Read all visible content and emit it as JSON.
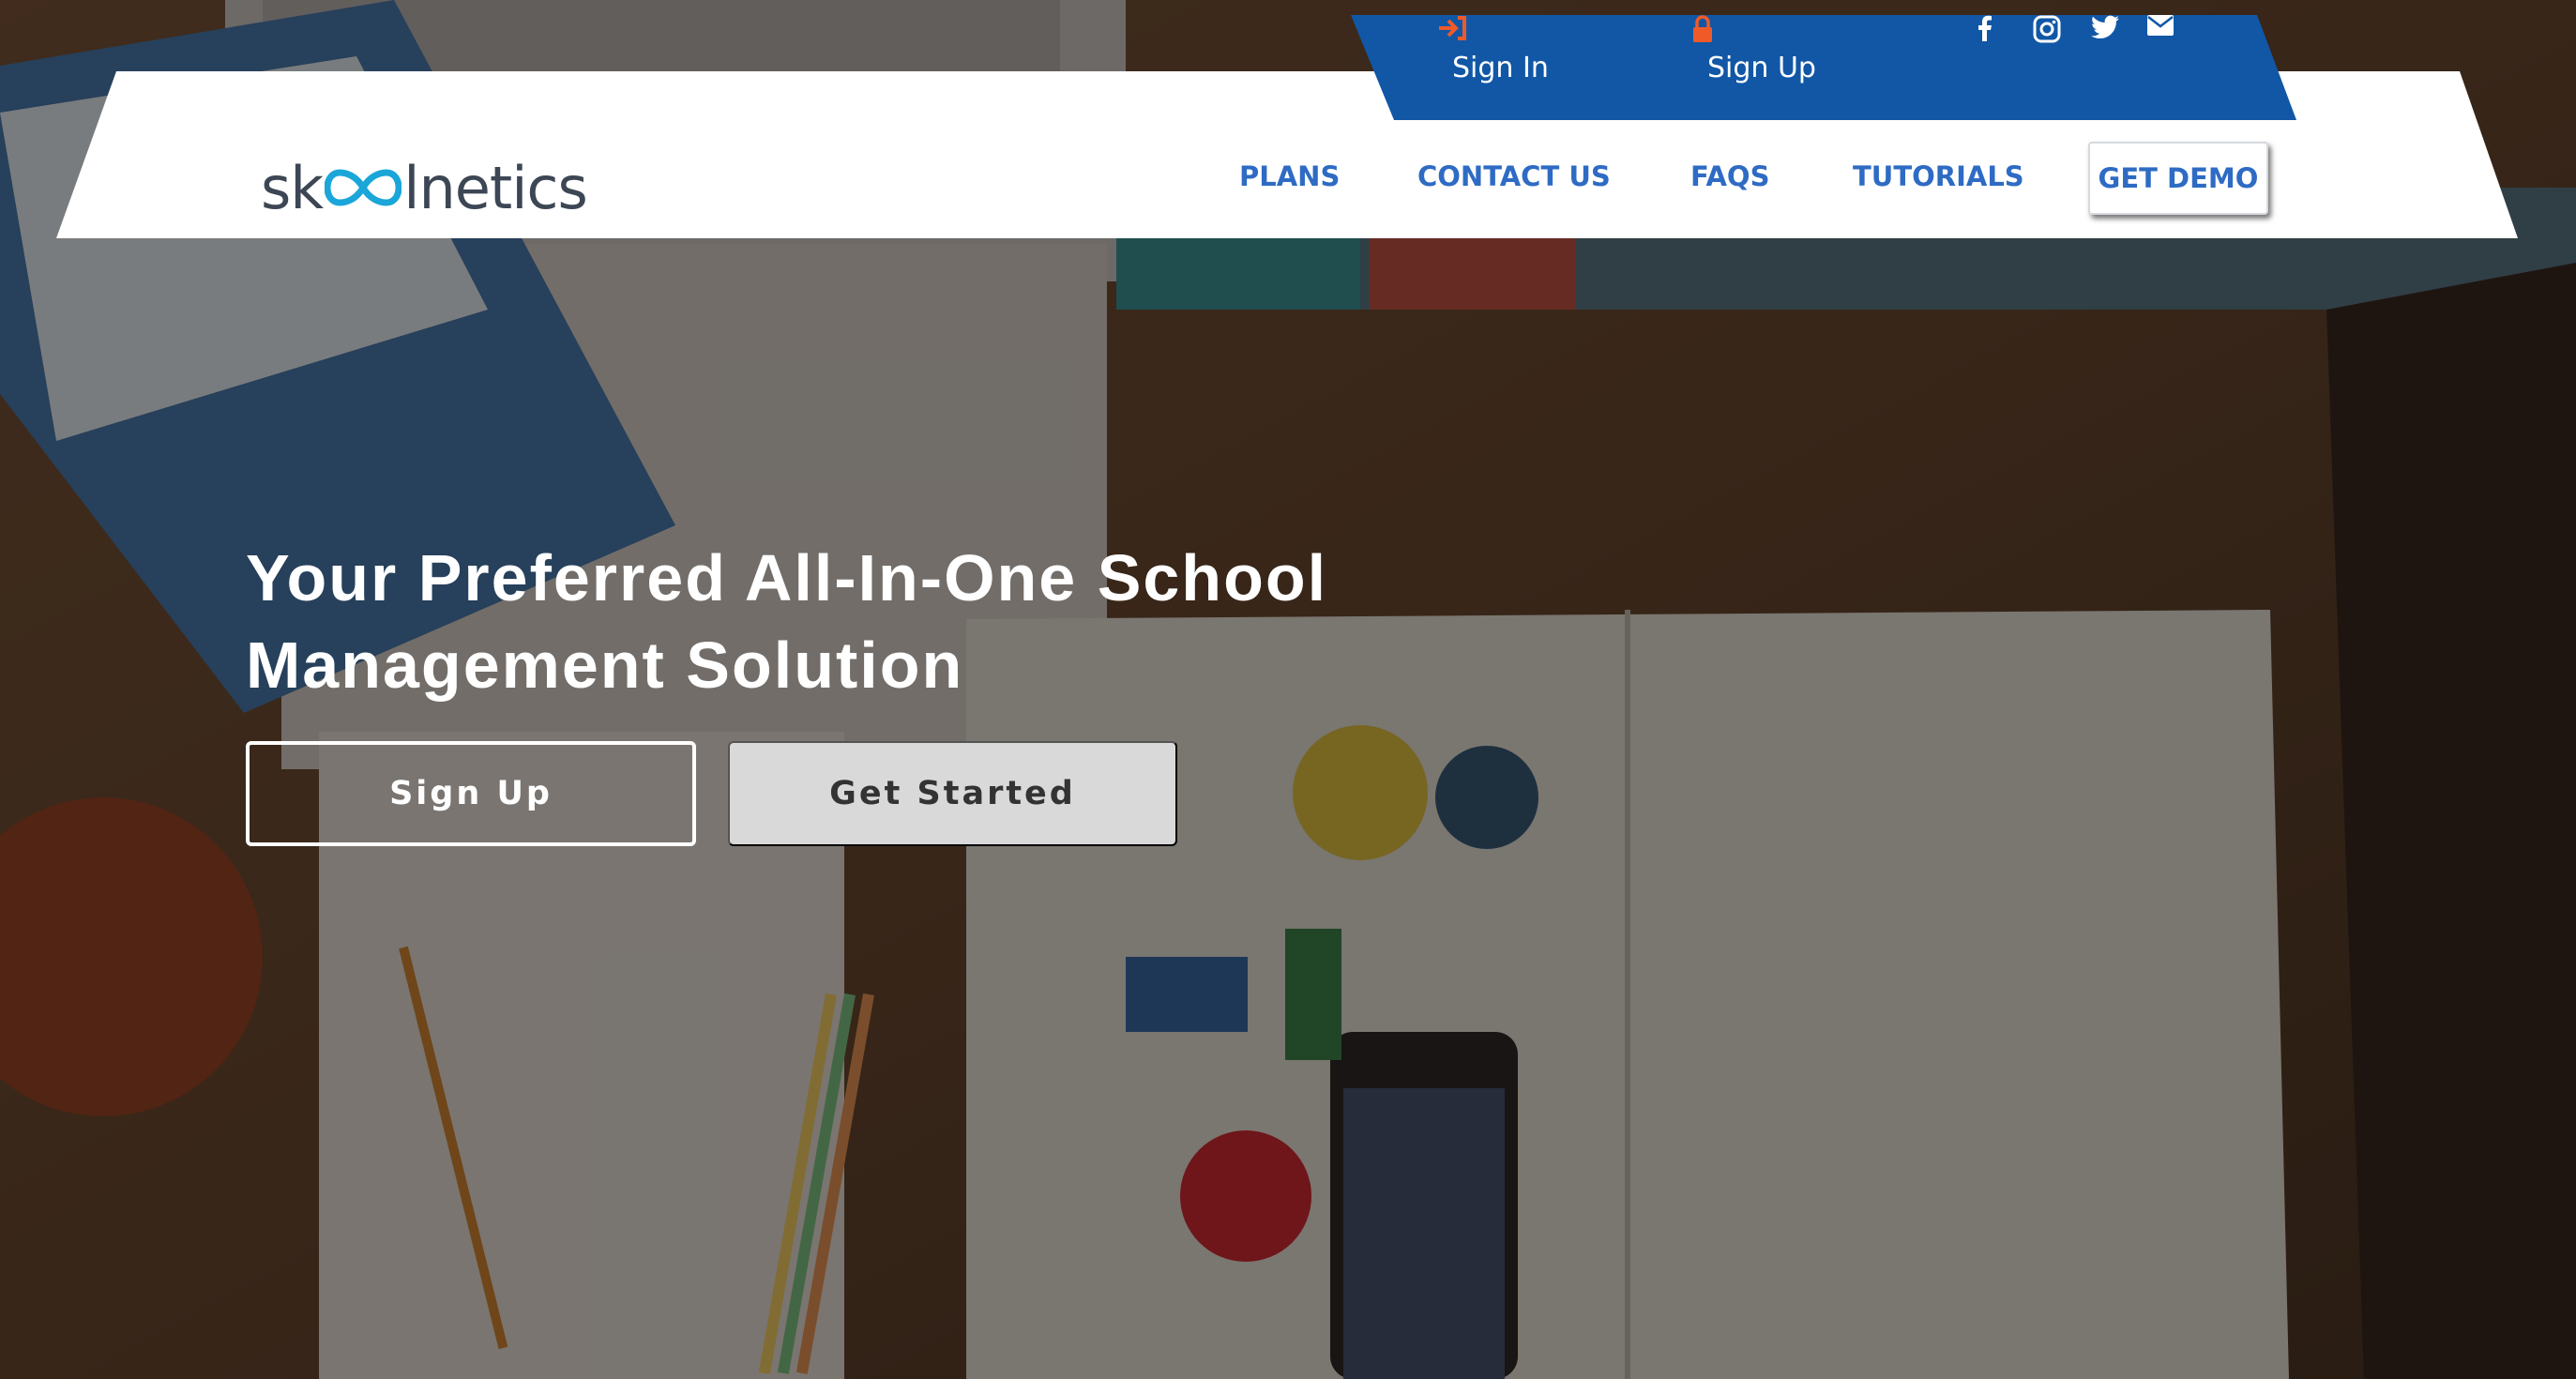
{
  "header": {
    "logo_text_before": "sk",
    "logo_text_after": "lnetics",
    "topbar": {
      "signin_label": "Sign In",
      "signup_label": "Sign Up",
      "social_icons": [
        "facebook-icon",
        "instagram-icon",
        "twitter-icon",
        "mail-icon"
      ]
    },
    "nav": {
      "plans": "PLANS",
      "contact": "CONTACT US",
      "faqs": "FAQS",
      "tutorials": "TUTORIALS",
      "demo": "GET DEMO"
    }
  },
  "hero": {
    "title_line1": "Your Preferred All-In-One School",
    "title_line2": "Management Solution",
    "signup_button": "Sign Up",
    "get_started_button": "Get Started"
  },
  "colors": {
    "topbar_blue": "#1157a6",
    "nav_blue": "#2e6bc4",
    "accent_orange": "#f05a28",
    "logo_gray": "#3d4654",
    "logo_teal": "#1aa6d9"
  }
}
